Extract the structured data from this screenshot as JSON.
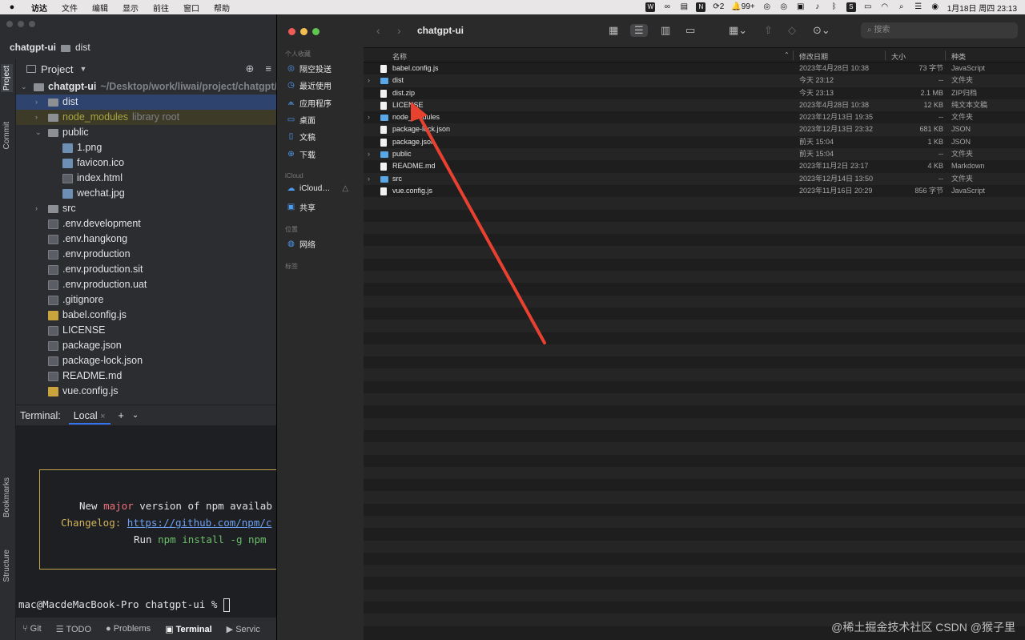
{
  "menubar": {
    "items": [
      "访达",
      "文件",
      "编辑",
      "显示",
      "前往",
      "窗口",
      "帮助"
    ],
    "tray_badges": [
      "2",
      "99+"
    ],
    "clock": "1月18日 周四 23:13"
  },
  "ide": {
    "crumb_project": "chatgpt-ui",
    "crumb_folder": "dist",
    "project_label": "Project",
    "left_tabs": [
      "Project",
      "Commit",
      "Bookmarks",
      "Structure"
    ],
    "tree": [
      {
        "name": "chatgpt-ui",
        "extra": "~/Desktop/work/liwai/project/chatgpt/c",
        "level": 0,
        "type": "folder",
        "expanded": true,
        "bold": true
      },
      {
        "name": "dist",
        "level": 1,
        "type": "folder",
        "expanded": false,
        "selected": true
      },
      {
        "name": "node_modules",
        "extra": "library root",
        "level": 1,
        "type": "folder",
        "expanded": false,
        "library": true
      },
      {
        "name": "public",
        "level": 1,
        "type": "folder",
        "expanded": true
      },
      {
        "name": "1.png",
        "level": 2,
        "type": "img"
      },
      {
        "name": "favicon.ico",
        "level": 2,
        "type": "img"
      },
      {
        "name": "index.html",
        "level": 2,
        "type": "file"
      },
      {
        "name": "wechat.jpg",
        "level": 2,
        "type": "img"
      },
      {
        "name": "src",
        "level": 1,
        "type": "folder",
        "expanded": false
      },
      {
        "name": ".env.development",
        "level": 1,
        "type": "file"
      },
      {
        "name": ".env.hangkong",
        "level": 1,
        "type": "file"
      },
      {
        "name": ".env.production",
        "level": 1,
        "type": "file"
      },
      {
        "name": ".env.production.sit",
        "level": 1,
        "type": "file"
      },
      {
        "name": ".env.production.uat",
        "level": 1,
        "type": "file"
      },
      {
        "name": ".gitignore",
        "level": 1,
        "type": "file"
      },
      {
        "name": "babel.config.js",
        "level": 1,
        "type": "js"
      },
      {
        "name": "LICENSE",
        "level": 1,
        "type": "file"
      },
      {
        "name": "package.json",
        "level": 1,
        "type": "file"
      },
      {
        "name": "package-lock.json",
        "level": 1,
        "type": "file"
      },
      {
        "name": "README.md",
        "level": 1,
        "type": "file"
      },
      {
        "name": "vue.config.js",
        "level": 1,
        "type": "js"
      }
    ],
    "terminal": {
      "label": "Terminal:",
      "tab": "Local",
      "line1_pre": "New ",
      "line1_major": "major",
      "line1_post": " version of npm availab",
      "line2_label": "Changelog: ",
      "line2_link": "https://github.com/npm/c",
      "line3_pre": "Run ",
      "line3_cmd": "npm install -g npm",
      "prompt": "mac@MacdeMacBook-Pro chatgpt-ui % "
    },
    "status": [
      "Git",
      "TODO",
      "Problems",
      "Terminal",
      "Servic"
    ]
  },
  "finder": {
    "title": "chatgpt-ui",
    "search_placeholder": "搜索",
    "sidebar": {
      "fav_section": "个人收藏",
      "favorites": [
        {
          "label": "隔空投送",
          "icon": "airdrop-icon"
        },
        {
          "label": "最近使用",
          "icon": "recent-icon"
        },
        {
          "label": "应用程序",
          "icon": "applications-icon"
        },
        {
          "label": "桌面",
          "icon": "desktop-icon"
        },
        {
          "label": "文稿",
          "icon": "documents-icon"
        },
        {
          "label": "下载",
          "icon": "downloads-icon"
        }
      ],
      "icloud_section": "iCloud",
      "icloud": [
        {
          "label": "iCloud…",
          "icon": "icloud-icon"
        },
        {
          "label": "共享",
          "icon": "shared-icon"
        }
      ],
      "location_section": "位置",
      "locations": [
        {
          "label": "网络",
          "icon": "network-icon"
        }
      ],
      "tags_section": "标签"
    },
    "columns": {
      "name": "名称",
      "date": "修改日期",
      "size": "大小",
      "kind": "种类"
    },
    "files": [
      {
        "name": "babel.config.js",
        "date": "2023年4月28日 10:38",
        "size": "73 字节",
        "kind": "JavaScript",
        "dir": false
      },
      {
        "name": "dist",
        "date": "今天 23:12",
        "size": "--",
        "kind": "文件夹",
        "dir": true
      },
      {
        "name": "dist.zip",
        "date": "今天 23:13",
        "size": "2.1 MB",
        "kind": "ZIP归档",
        "dir": false
      },
      {
        "name": "LICENSE",
        "date": "2023年4月28日 10:38",
        "size": "12 KB",
        "kind": "纯文本文稿",
        "dir": false
      },
      {
        "name": "node_modules",
        "date": "2023年12月13日 19:35",
        "size": "--",
        "kind": "文件夹",
        "dir": true
      },
      {
        "name": "package-lock.json",
        "date": "2023年12月13日 23:32",
        "size": "681 KB",
        "kind": "JSON",
        "dir": false
      },
      {
        "name": "package.json",
        "date": "前天 15:04",
        "size": "1 KB",
        "kind": "JSON",
        "dir": false
      },
      {
        "name": "public",
        "date": "前天 15:04",
        "size": "--",
        "kind": "文件夹",
        "dir": true
      },
      {
        "name": "README.md",
        "date": "2023年11月2日 23:17",
        "size": "4 KB",
        "kind": "Markdown",
        "dir": false
      },
      {
        "name": "src",
        "date": "2023年12月14日 13:50",
        "size": "--",
        "kind": "文件夹",
        "dir": true
      },
      {
        "name": "vue.config.js",
        "date": "2023年11月16日 20:29",
        "size": "856 字节",
        "kind": "JavaScript",
        "dir": false
      }
    ]
  },
  "watermark": "@稀土掘金技术社区 CSDN @猴子里",
  "colors": {
    "annotation_arrow": "#e8412f",
    "selection": "#2e436e",
    "folder_blue": "#5aa7e8"
  }
}
